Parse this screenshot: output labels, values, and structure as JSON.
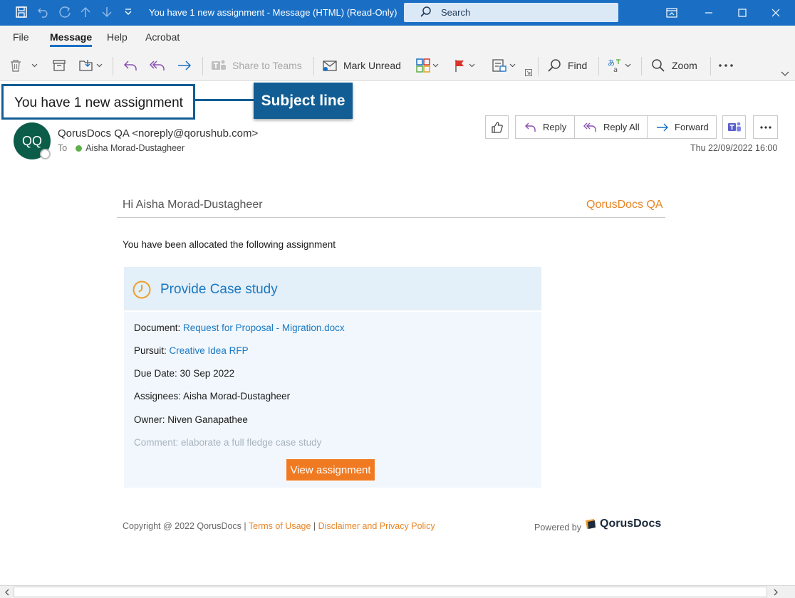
{
  "window": {
    "title": "You have 1 new assignment  -  Message (HTML) (Read-Only)",
    "search_placeholder": "Search"
  },
  "menu": {
    "tabs": [
      {
        "label": "File"
      },
      {
        "label": "Message",
        "active": true
      },
      {
        "label": "Help"
      },
      {
        "label": "Acrobat"
      }
    ]
  },
  "ribbon": {
    "share_teams": "Share to Teams",
    "mark_unread": "Mark Unread",
    "find": "Find",
    "zoom": "Zoom"
  },
  "annotation": {
    "subject_text": "You have 1 new assignment",
    "callout_label": "Subject line"
  },
  "header": {
    "avatar_initials": "QQ",
    "sender": "QorusDocs QA <noreply@qorushub.com>",
    "to_label": "To",
    "recipient": "Aisha Morad-Dustagheer",
    "reply": "Reply",
    "reply_all": "Reply All",
    "forward": "Forward",
    "date": "Thu 22/09/2022 16:00"
  },
  "body": {
    "greeting": "Hi Aisha Morad-Dustagheer",
    "brand": "QorusDocs QA",
    "intro": "You have been allocated the following assignment",
    "card": {
      "title": "Provide Case study",
      "document_label": "Document: ",
      "document_value": "Request for Proposal - Migration.docx",
      "pursuit_label": "Pursuit: ",
      "pursuit_value": "Creative Idea RFP",
      "due_label": "Due Date: ",
      "due_value": "30 Sep 2022",
      "assignees_label": "Assignees: ",
      "assignees_value": "Aisha Morad-Dustagheer",
      "owner_label": "Owner: ",
      "owner_value": "Niven Ganapathee",
      "comment": "Comment: elaborate a full fledge case study",
      "button": "View assignment"
    }
  },
  "footer": {
    "copyright": "Copyright @ 2022 QorusDocs | ",
    "terms": "Terms of Usage",
    "sep": " | ",
    "disclaimer": "Disclaimer and Privacy Policy",
    "powered_by": "Powered by",
    "logo_text": "QorusDocs"
  },
  "colors": {
    "titlebar": "#1a6fc4",
    "accent_orange": "#e88526",
    "link_blue": "#1a78c2",
    "callout": "#125e94"
  },
  "icons": [
    "save-icon",
    "undo-icon",
    "redo-icon",
    "up-icon",
    "down-icon",
    "customize-icon",
    "search-icon",
    "ribbon-display-icon",
    "minimize-icon",
    "maximize-icon",
    "close-icon",
    "delete-icon",
    "archive-icon",
    "move-icon",
    "reply-icon",
    "reply-all-icon",
    "forward-icon",
    "teams-icon",
    "mail-unread-icon",
    "categorize-icon",
    "flag-icon",
    "policy-icon",
    "find-icon",
    "translate-icon",
    "zoom-icon",
    "more-icon",
    "like-icon",
    "clock-icon"
  ]
}
